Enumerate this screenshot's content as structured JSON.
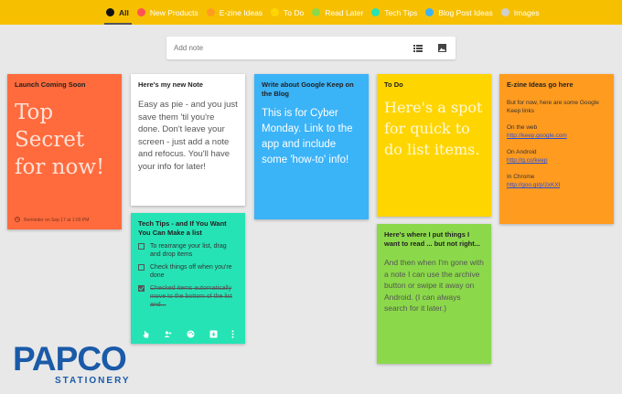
{
  "labels": [
    {
      "name": "All",
      "color": "#111111"
    },
    {
      "name": "New Products",
      "color": "#ff5252"
    },
    {
      "name": "E-zine Ideas",
      "color": "#ff9b1f"
    },
    {
      "name": "To Do",
      "color": "#ffd500"
    },
    {
      "name": "Read Later",
      "color": "#8bd94a"
    },
    {
      "name": "Tech Tips",
      "color": "#26e3b5"
    },
    {
      "name": "Blog Post Ideas",
      "color": "#3bb3f7"
    },
    {
      "name": "Images",
      "color": "#cfcfcf"
    }
  ],
  "search": {
    "placeholder": "Add note"
  },
  "notes": {
    "launch": {
      "title": "Launch Coming Soon",
      "body": "Top Secret for now!",
      "reminder": "Reminder on Sep 17 at 1:00 PM"
    },
    "new_note": {
      "title": "Here's my new Note",
      "body": "Easy as pie - and you just save them 'til you're done.  Don't leave your screen - just add a note and refocus.  You'll have your info for later!"
    },
    "tech_tips": {
      "title": "Tech Tips - and If You Want You Can Make a list",
      "items": [
        {
          "text": "To rearrange your list, drag and drop items",
          "done": false
        },
        {
          "text": "Check things off when you're done",
          "done": false
        },
        {
          "text": "Checked items automatically move to the bottom of the list and...",
          "done": true
        }
      ]
    },
    "google_keep": {
      "title": "Write about Google Keep on the Blog",
      "body": "This is for Cyber Monday.  Link to the app and include some 'how-to' info!"
    },
    "todo": {
      "title": "To Do",
      "body": "Here's a spot for quick to do list items."
    },
    "read_later": {
      "title": "Here's where I put things I want to read ... but not right...",
      "body": "And then when I'm gone with a note I can use the archive button or swipe it away on Android. (I can always search for it later.)"
    },
    "ezine": {
      "title": "E-zine Ideas go here",
      "intro": "But for now, here are some Google Keep links",
      "web_label": "On the web",
      "web_link": "http://keep.google.com",
      "android_label": "On Android",
      "android_link": "http://g.co/keep",
      "chrome_label": "In Chrome",
      "chrome_link": "http://goo.gl/p/2xKXl"
    }
  },
  "logo": {
    "word": "PAPCO",
    "sub": "STATIONERY"
  }
}
